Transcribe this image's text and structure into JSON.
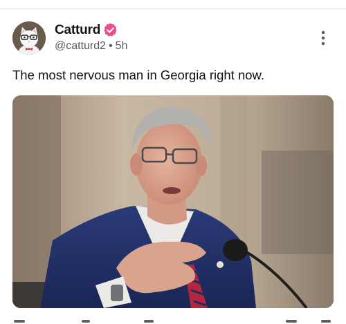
{
  "post": {
    "author": {
      "display_name": "Catturd",
      "handle": "@catturd2",
      "separator": "•",
      "time_ago": "5h",
      "verified": true
    },
    "text": "The most nervous man in Georgia right now.",
    "icons": {
      "verified": "verified-badge-icon",
      "menu": "more-options-icon"
    },
    "colors": {
      "verified_badge": "#ec4e8d",
      "meta_text": "#54595f"
    }
  }
}
